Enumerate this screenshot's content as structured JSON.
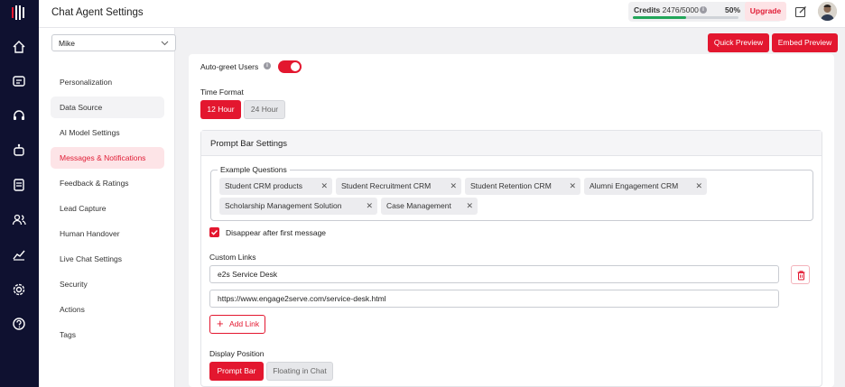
{
  "header": {
    "title": "Chat Agent Settings",
    "credits_label": "Credits",
    "credits_value": "2476/5000",
    "credits_percent": "50%",
    "credits_fraction": 0.5,
    "upgrade_label": "Upgrade"
  },
  "rail": {
    "icons": [
      "home-icon",
      "chat-icon",
      "headset-icon",
      "bot-icon",
      "training-icon",
      "users-icon",
      "analytics-icon",
      "settings-icon",
      "help-icon"
    ]
  },
  "sidebar": {
    "agent_select": "Mike",
    "items": [
      {
        "label": "Personalization"
      },
      {
        "label": "Data Source"
      },
      {
        "label": "AI Model Settings"
      },
      {
        "label": "Messages & Notifications"
      },
      {
        "label": "Feedback & Ratings"
      },
      {
        "label": "Lead Capture"
      },
      {
        "label": "Human Handover"
      },
      {
        "label": "Live Chat Settings"
      },
      {
        "label": "Security"
      },
      {
        "label": "Actions"
      },
      {
        "label": "Tags"
      }
    ]
  },
  "actions": {
    "quick_preview": "Quick Preview",
    "embed_preview": "Embed Preview"
  },
  "main": {
    "auto_greet_label": "Auto-greet Users",
    "time_format_label": "Time Format",
    "time_12": "12 Hour",
    "time_24": "24 Hour",
    "prompt_bar_title": "Prompt Bar Settings",
    "example_questions_label": "Example Questions",
    "chips": [
      {
        "label": "Student CRM products"
      },
      {
        "label": "Student Recruitment CRM"
      },
      {
        "label": "Student Retention CRM"
      },
      {
        "label": "Alumni Engagement CRM"
      },
      {
        "label": "Scholarship Management Solution"
      },
      {
        "label": "Case Management"
      }
    ],
    "disappear_label": "Disappear after first message",
    "custom_links_label": "Custom Links",
    "link_name": "e2s Service Desk",
    "link_url": "https://www.engage2serve.com/service-desk.html",
    "add_link_label": "Add Link",
    "display_position_label": "Display Position",
    "position_prompt_bar": "Prompt Bar",
    "position_floating": "Floating in Chat"
  },
  "colors": {
    "accent": "#e3172f",
    "rail": "#0f1130",
    "active_bg": "#fde4e7"
  }
}
